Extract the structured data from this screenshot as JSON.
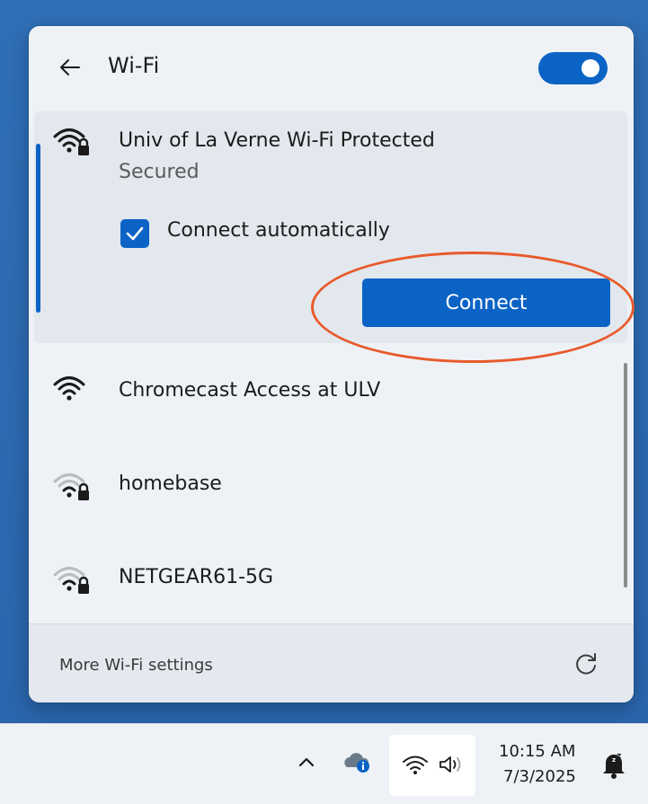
{
  "flyout": {
    "title": "Wi-Fi",
    "wifi_enabled": true,
    "back_icon": "arrow-left-icon"
  },
  "networks": [
    {
      "name": "Univ of La Verne Wi-Fi Protected",
      "status": "Secured",
      "secured": true,
      "expanded": true,
      "connect_automatically_label": "Connect automatically",
      "connect_automatically_checked": true,
      "connect_label": "Connect"
    },
    {
      "name": "Chromecast Access at ULV",
      "secured": false,
      "signal": "full"
    },
    {
      "name": "homebase",
      "secured": true,
      "signal": "weak"
    },
    {
      "name": "NETGEAR61-5G",
      "secured": true,
      "signal": "weak"
    }
  ],
  "footer": {
    "more_settings_label": "More Wi-Fi settings",
    "refresh_icon": "refresh-icon"
  },
  "taskbar": {
    "time": "10:15 AM",
    "date": "7/3/2025",
    "icons": [
      "chevron-up-icon",
      "onedrive-icon",
      "wifi-icon",
      "speaker-icon",
      "notification-bell-icon"
    ]
  },
  "colors": {
    "accent": "#0b63c5",
    "annotation": "#e85a2c",
    "flyout_bg": "#eef2f6"
  }
}
